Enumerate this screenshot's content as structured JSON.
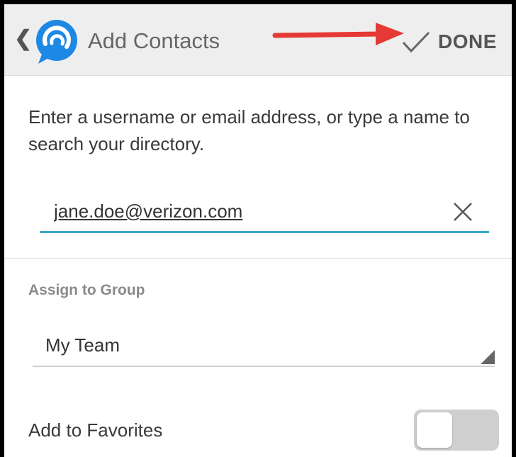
{
  "header": {
    "title": "Add Contacts",
    "done_label": "DONE",
    "back_icon": "chevron-left-icon",
    "logo_icon": "chat-bubble-logo-icon",
    "done_icon": "check-icon"
  },
  "form": {
    "instructions": "Enter a username or email address, or type a name to search your directory.",
    "search_value": "jane.doe@verizon.com",
    "clear_icon": "close-icon",
    "group_label": "Assign to Group",
    "group_value": "My Team",
    "favorites_label": "Add to Favorites",
    "favorites_enabled": false
  },
  "colors": {
    "brand_blue": "#1e88e5",
    "input_underline": "#3aa7c8",
    "annotation_arrow": "#e53935",
    "toggle_off": "#cfcfcf"
  }
}
